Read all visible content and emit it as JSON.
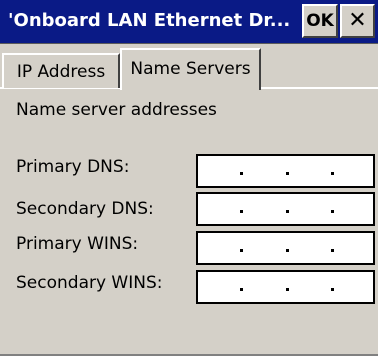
{
  "window": {
    "title": "'Onboard LAN Ethernet Dr...",
    "ok_label": "OK",
    "close_label": "✕"
  },
  "tabs": [
    {
      "label": "IP Address",
      "active": false
    },
    {
      "label": "Name Servers",
      "active": true
    }
  ],
  "name_servers": {
    "section_label": "Name server addresses",
    "fields": [
      {
        "label": "Primary DNS:",
        "value": ""
      },
      {
        "label": "Secondary DNS:",
        "value": ""
      },
      {
        "label": "Primary WINS:",
        "value": ""
      },
      {
        "label": "Secondary WINS:",
        "value": ""
      }
    ]
  },
  "colors": {
    "titlebar": "#0a1a86",
    "face": "#d4d0c8",
    "field_bg": "#ffffff"
  }
}
